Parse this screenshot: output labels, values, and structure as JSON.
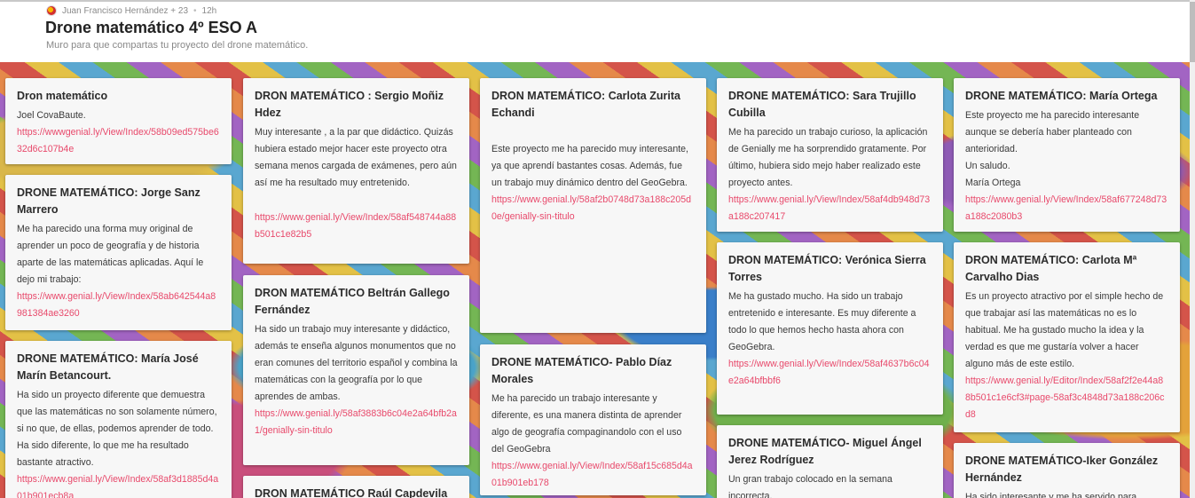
{
  "header": {
    "author": "Juan Francisco Hernández + 23",
    "time": "12h",
    "title": "Drone matemático 4º ESO A",
    "subtitle": "Muro para que compartas tu proyecto del drone matemático."
  },
  "columns": [
    [
      {
        "title": "Dron matemático",
        "lines": [
          "Joel CovaBaute."
        ],
        "link": "https://wwwgenial.ly/View/Index/58b09ed575be632d6c107b4e"
      },
      {
        "title": "DRONE MATEMÁTICO: Jorge Sanz Marrero",
        "lines": [
          "Me ha parecido una forma muy original de aprender un poco de geografía y de historia aparte de las matemáticas aplicadas. Aquí le dejo mi trabajo:"
        ],
        "link": "https://www.genial.ly/View/Index/58ab642544a8981384ae3260"
      },
      {
        "title": "DRONE MATEMÁTICO: María José Marín Betancourt.",
        "lines": [
          "Ha sido un proyecto diferente que demuestra que las matemáticas no son solamente número, si no que, de ellas, podemos aprender de todo. Ha sido diferente, lo que me ha resultado bastante atractivo."
        ],
        "link": "https://www.genial.ly/View/Index/58af3d1885d4a01b901ecb8a"
      }
    ],
    [
      {
        "title": "DRON MATEMÁTICO : Sergio Moñiz Hdez",
        "lines": [
          "Muy interesante , a la par que didáctico. Quizás hubiera estado mejor hacer este proyecto otra semana menos cargada de exámenes, pero aún así me ha resultado muy entretenido."
        ],
        "link": "https://www.genial.ly/View/Index/58af548744a88b501c1e82b5"
      },
      {
        "title": "DRON MATEMÁTICO Beltrán Gallego Fernández",
        "lines": [
          "Ha sido un trabajo muy interesante y didáctico, además te enseña algunos monumentos que no eran comunes del territorio español y combina la matemáticas con la geografía por lo que aprendes de ambas."
        ],
        "link": "https://www.genial.ly/58af3883b6c04e2a64bfb2a1/genially-sin-titulo"
      },
      {
        "title": "DRON MATEMÁTICO Raúl Capdevila",
        "lines": [],
        "link": ""
      }
    ],
    [
      {
        "title": "DRON MATEMÁTICO: Carlota Zurita Echandi",
        "lines": [
          "Este proyecto me ha parecido muy interesante, ya que aprendí bastantes cosas. Además, fue un trabajo muy dinámico dentro del GeoGebra."
        ],
        "link": "https://www.genial.ly/58af2b0748d73a188c205d0e/genially-sin-titulo"
      },
      {
        "title": "DRONE MATEMÁTICO- Pablo Díaz Morales",
        "lines": [
          "Me ha parecido un trabajo interesante y diferente, es una manera distinta de aprender algo de geografía compaginandolo con el uso del GeoGebra"
        ],
        "link": "https://www.genial.ly/View/Index/58af15c685d4a01b901eb178"
      }
    ],
    [
      {
        "title": "DRONE MATEMÁTICO: Sara Trujillo Cubilla",
        "lines": [
          "Me ha parecido un trabajo curioso, la aplicación de Genially me ha sorprendido gratamente. Por último, hubiera sido mejo haber realizado este proyecto antes."
        ],
        "link": "https://www.genial.ly/View/Index/58af4db948d73a188c207417"
      },
      {
        "title": "DRON MATEMÁTICO: Verónica Sierra Torres",
        "lines": [
          "Me ha gustado mucho. Ha sido un trabajo entretenido e interesante. Es muy diferente a todo lo que hemos hecho hasta ahora con GeoGebra."
        ],
        "link": "https://www.genial.ly/View/Index/58af4637b6c04e2a64bfbbf6"
      },
      {
        "title": "DRONE MATEMÁTICO- Miguel Ángel Jerez Rodríguez",
        "lines": [
          "Un gran trabajo colocado en la semana incorrecta."
        ],
        "link": ""
      }
    ],
    [
      {
        "title": "DRONE MATEMÁTICO: María Ortega",
        "lines": [
          "Este proyecto me ha parecido interesante aunque se debería haber planteado con anterioridad.",
          "Un saludo.",
          "María Ortega"
        ],
        "link": "https://www.genial.ly/View/Index/58af677248d73a188c2080b3"
      },
      {
        "title": "DRON MATEMÁTICO: Carlota Mª Carvalho Dias",
        "lines": [
          "Es un proyecto atractivo por el simple hecho de que trabajar así las matemáticas no es lo habitual. Me ha gustado mucho la idea y la verdad es que me gustaría volver a hacer alguno más de este estilo."
        ],
        "link": "https://www.genial.ly/Editor/Index/58af2f2e44a88b501c1e6cf3#page-58af3c4848d73a188c206cd8"
      },
      {
        "title": "DRONE MATEMÁTICO-Iker González Hernández",
        "lines": [
          "Ha sido interesante y me ha servido para"
        ],
        "link": ""
      }
    ]
  ]
}
